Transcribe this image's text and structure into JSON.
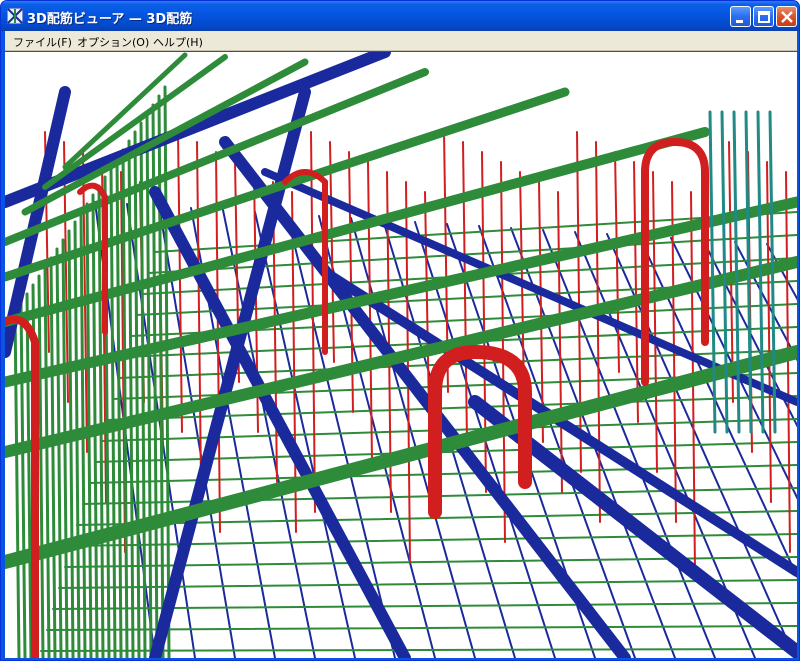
{
  "window": {
    "title": "3D配筋ビューア — 3D配筋",
    "controls": [
      "minimize",
      "maximize",
      "close"
    ]
  },
  "menu": {
    "items": [
      {
        "label": "ファイル(F)"
      },
      {
        "label": "オプション(O)"
      },
      {
        "label": "ヘルプ(H)"
      }
    ]
  },
  "viewport": {
    "description_icon": "3d-rebar-view",
    "colors": {
      "main_bar": "#1a2a9c",
      "distribution_bar": "#2e8b3a",
      "stirrup": "#d11f1f",
      "teal_bar": "#1f8a86"
    }
  }
}
